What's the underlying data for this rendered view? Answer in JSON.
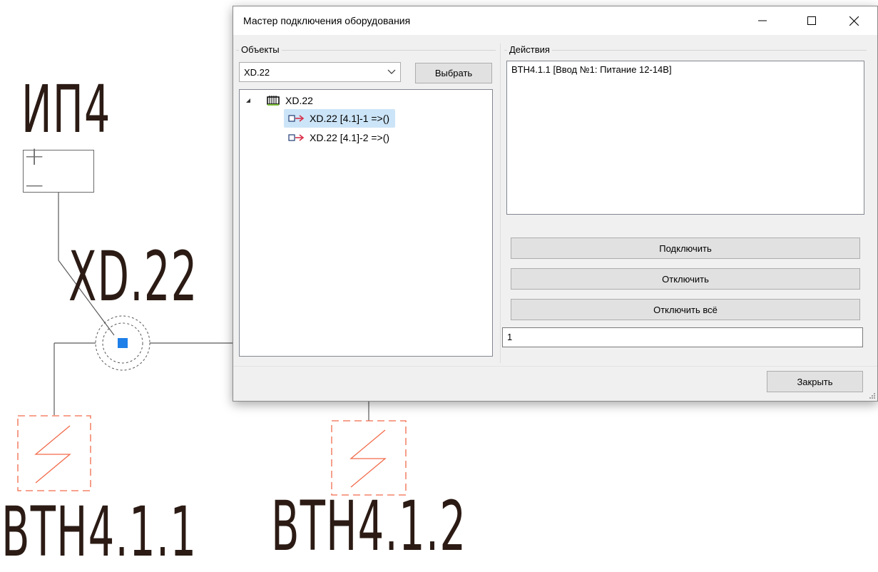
{
  "drawing": {
    "label_ip4": "ИП4",
    "terminal_symbols": "+ −",
    "label_xd": "XD.22",
    "label_vth1": "BTH4.1.1",
    "label_vth2": "BTH4.1.2",
    "colors": {
      "ink": "#2b1b14",
      "wire": "#5a5a5a",
      "device": "#f26b4a",
      "node": "#1e7fe8"
    }
  },
  "dialog": {
    "title": "Мастер подключения оборудования",
    "window_controls": {
      "minimize": "minimize-icon",
      "maximize": "maximize-icon",
      "close": "close-icon"
    },
    "objects_group": {
      "label": "Объекты",
      "combo_value": "XD.22",
      "select_button": "Выбрать",
      "tree": [
        {
          "label": "XD.22",
          "icon": "connector-block-icon",
          "expanded": true
        },
        {
          "label": "XD.22 [4.1]-1 =>()",
          "icon": "pin-arrow-icon",
          "selected": true
        },
        {
          "label": "XD.22 [4.1]-2 =>()",
          "icon": "pin-arrow-icon",
          "selected": false
        }
      ]
    },
    "actions_group": {
      "label": "Действия",
      "items": [
        "BTH4.1.1 [Ввод №1: Питание 12-14В]"
      ],
      "connect_button": "Подключить",
      "disconnect_button": "Отключить",
      "disconnect_all_button": "Отключить всё",
      "counter_value": "1"
    },
    "close_button": "Закрыть",
    "colors": {
      "selection": "#cce4f7",
      "pin_arrow": "#d9304a"
    }
  }
}
